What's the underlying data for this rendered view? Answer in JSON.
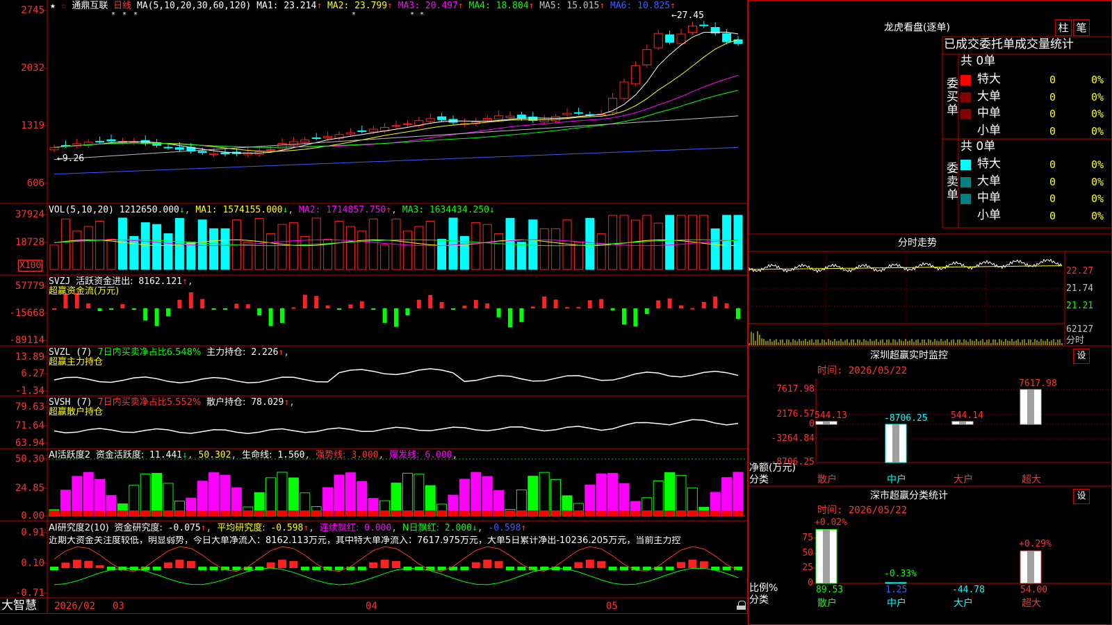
{
  "main": {
    "stock_name": "通鼎互联",
    "period": "日线",
    "ma_header": "MA(5,10,20,30,60,120)",
    "ma_values": [
      {
        "label": "MA1:",
        "value": "23.214",
        "color": "#ffffff"
      },
      {
        "label": "MA2:",
        "value": "23.799",
        "color": "#ffff00"
      },
      {
        "label": "MA3:",
        "value": "20.497",
        "color": "#ff00ff"
      },
      {
        "label": "MA4:",
        "value": "18.804",
        "color": "#00ff00"
      },
      {
        "label": "MA5:",
        "value": "15.015",
        "color": "#c0c0c0"
      },
      {
        "label": "MA6:",
        "value": "10.825",
        "color": "#3b5bff"
      }
    ],
    "y_ticks": [
      "2745",
      "2032",
      "1319",
      "606"
    ],
    "high_label": "27.45",
    "low_label": "9.26"
  },
  "vol": {
    "header": "VOL(5,10,20)",
    "value": "1212650.000",
    "ma1_label": "MA1:",
    "ma1": "1574155.000",
    "ma2_label": "MA2:",
    "ma2": "1714857.750",
    "ma3_label": "MA3:",
    "ma3": "1634434.250",
    "y_ticks": [
      "37924",
      "18728"
    ],
    "unit": "X100"
  },
  "svzj": {
    "header": "SVZJ",
    "line1_label": "活跃资金进出:",
    "line1_value": "8162.121",
    "line2": "超赢资金流(万元)",
    "y_ticks": [
      "57779",
      "-15668",
      "-89114"
    ]
  },
  "svzl": {
    "header": "SVZL (7)",
    "seg1": "7日内买卖净占比6.548%",
    "seg2": "主力持仓:",
    "value": "2.226",
    "line2": "超赢主力持仓",
    "y_ticks": [
      "13.89",
      "6.27",
      "-1.34"
    ]
  },
  "svsh": {
    "header": "SVSH (7)",
    "seg1": "7日内买卖净占比5.552%",
    "seg2": "散户持仓:",
    "value": "78.029",
    "line2": "超赢散户持仓",
    "y_ticks": [
      "79.63",
      "71.64",
      "63.94"
    ]
  },
  "ai1": {
    "header": "AI活跃度2",
    "seg1": "资金活跃度:",
    "v1": "11.441",
    "v2": "50.302",
    "seg3": "生命线:",
    "v3": "1.560",
    "seg4": "强势线:",
    "v4": "3.000",
    "seg5": "爆发线:",
    "v5": "6.000",
    "y_ticks": [
      "50.30",
      "24.85",
      "0.00"
    ]
  },
  "ai2": {
    "header": "AI研究度2(10)",
    "seg1": "资金研究度:",
    "v1": "-0.075",
    "seg2": "平均研究度:",
    "v2": "-0.598",
    "seg3": "连续飘红:",
    "v3": "0.000",
    "seg4": "N日飘红:",
    "v4": "2.000",
    "v5": "-0.598",
    "line2": "近期大资金关注度较低，明显弱势，今日大单净流入：8162.113万元，其中特大单净流入：7617.975万元，大单5日累计净出-10236.205万元，当前主力控",
    "y_ticks": [
      "0.91",
      "0.10",
      "-0.71"
    ]
  },
  "bottom": {
    "brand": "大智慧",
    "date_start": "2026/02",
    "months": [
      "03",
      "04",
      "05"
    ]
  },
  "right": {
    "lhb_title": "龙虎看盘(逐单)",
    "btn_bar": "柱",
    "btn_pen": "笔",
    "stats_title": "已成交委托单成交量统计",
    "buy_label": "委买单",
    "sell_label": "委卖单",
    "buy_total": "共 0单",
    "sell_total": "共 0单",
    "buy_rows": [
      {
        "name": "特大",
        "count": "0",
        "pct": "0%",
        "color": "#ff0000"
      },
      {
        "name": "大单",
        "count": "0",
        "pct": "0%",
        "color": "#800000"
      },
      {
        "name": "中单",
        "count": "0",
        "pct": "0%",
        "color": "#800000"
      },
      {
        "name": "小单",
        "count": "0",
        "pct": "0%",
        "color": "#000000"
      }
    ],
    "sell_rows": [
      {
        "name": "特大",
        "count": "0",
        "pct": "0%",
        "color": "#00ffff"
      },
      {
        "name": "大单",
        "count": "0",
        "pct": "0%",
        "color": "#008080"
      },
      {
        "name": "中单",
        "count": "0",
        "pct": "0%",
        "color": "#008080"
      },
      {
        "name": "小单",
        "count": "0",
        "pct": "0%",
        "color": "#000000"
      }
    ],
    "tick_title": "分时走势",
    "tick_labels": [
      "22.27",
      "21.74",
      "21.21",
      "62127",
      "分时"
    ],
    "sz_title": "深圳超赢实时监控",
    "sz_btn": "设",
    "sz_date": "时间: 2026/05/22",
    "sz_yticks": [
      "7617.98",
      "2176.57",
      "0",
      "-3264.84",
      "-8706.25"
    ],
    "sz_unit": "净额(万元)",
    "sz_cat_label": "分类",
    "sz_bars": [
      {
        "cat": "散户",
        "value": 544.13,
        "label": "544.13"
      },
      {
        "cat": "中户",
        "value": -8706.25,
        "label": "-8706.25"
      },
      {
        "cat": "大户",
        "value": 544.14,
        "label": "544.14"
      },
      {
        "cat": "超大",
        "value": 7617.98,
        "label": "7617.98"
      }
    ],
    "ss_title": "深市超赢分类统计",
    "ss_btn": "设",
    "ss_date": "时间: 2026/05/22",
    "ss_yticks": [
      "75",
      "50",
      "25",
      "0"
    ],
    "ss_unit": "比例%",
    "ss_cat_label": "分类",
    "ss_bars": [
      {
        "cat": "散户",
        "value": 89.53,
        "top": "+0.02%",
        "bottom": "89.53"
      },
      {
        "cat": "中户",
        "value": 1.25,
        "top": "-0.33%",
        "bottom": "1.25"
      },
      {
        "cat": "大户",
        "value": 0,
        "top": "",
        "bottom": "-44.78"
      },
      {
        "cat": "超大",
        "value": 54.0,
        "top": "+0.29%",
        "bottom": "54.00"
      }
    ]
  },
  "colors": {
    "up": "#ff2020",
    "down": "#00ffff",
    "frame": "#c00000",
    "green": "#00ff00",
    "magenta": "#ff00ff"
  }
}
